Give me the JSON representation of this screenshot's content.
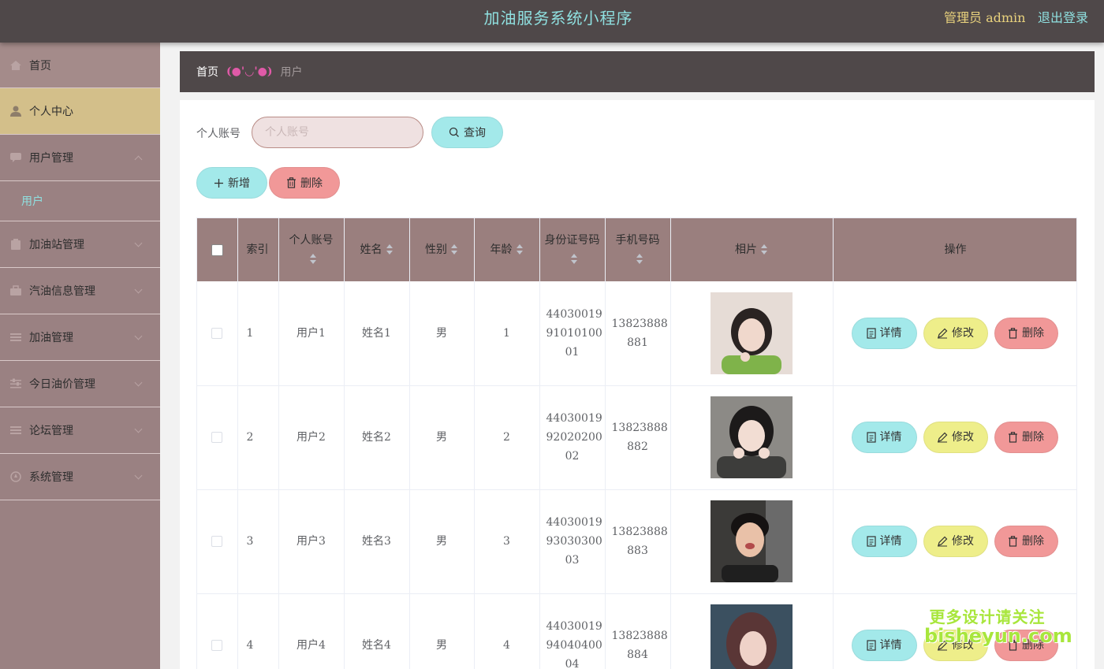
{
  "header": {
    "title": "加油服务系统小程序",
    "admin_label": "管理员 admin",
    "logout_label": "退出登录"
  },
  "sidebar": {
    "items": [
      {
        "label": "首页",
        "icon": "home-icon"
      },
      {
        "label": "个人中心",
        "icon": "user-icon"
      },
      {
        "label": "用户管理",
        "icon": "chat-icon",
        "expanded": true,
        "children": [
          "用户"
        ]
      },
      {
        "label": "加油站管理",
        "icon": "clipboard-icon"
      },
      {
        "label": "汽油信息管理",
        "icon": "briefcase-icon"
      },
      {
        "label": "加油管理",
        "icon": "list-icon"
      },
      {
        "label": "今日油价管理",
        "icon": "sliders-icon"
      },
      {
        "label": "论坛管理",
        "icon": "list-icon"
      },
      {
        "label": "系统管理",
        "icon": "compass-icon"
      }
    ]
  },
  "breadcrumb": {
    "home": "首页",
    "separator": "(●'◡'●)",
    "current": "用户"
  },
  "search": {
    "label": "个人账号",
    "placeholder": "个人账号",
    "value": "",
    "button_label": "查询"
  },
  "actions": {
    "add_label": "新增",
    "delete_label": "删除"
  },
  "table": {
    "columns": [
      "索引",
      "个人账号",
      "姓名",
      "性别",
      "年龄",
      "身份证号码",
      "手机号码",
      "相片",
      "操作"
    ],
    "rows": [
      {
        "index": "1",
        "account": "用户1",
        "name": "姓名1",
        "gender": "男",
        "age": "1",
        "id_lines": [
          "44030019",
          "91010100",
          "01"
        ],
        "phone_lines": [
          "13823888",
          "881"
        ]
      },
      {
        "index": "2",
        "account": "用户2",
        "name": "姓名2",
        "gender": "男",
        "age": "2",
        "id_lines": [
          "44030019",
          "92020200",
          "02"
        ],
        "phone_lines": [
          "13823888",
          "882"
        ]
      },
      {
        "index": "3",
        "account": "用户3",
        "name": "姓名3",
        "gender": "男",
        "age": "3",
        "id_lines": [
          "44030019",
          "93030300",
          "03"
        ],
        "phone_lines": [
          "13823888",
          "883"
        ]
      },
      {
        "index": "4",
        "account": "用户4",
        "name": "姓名4",
        "gender": "男",
        "age": "4",
        "id_lines": [
          "44030019",
          "94040400",
          "04"
        ],
        "phone_lines": [
          "13823888",
          "884"
        ]
      }
    ],
    "row_actions": {
      "detail_label": "详情",
      "edit_label": "修改",
      "delete_label": "删除"
    }
  },
  "watermark": {
    "line1": "更多设计请关注",
    "line2": "bisheyun.com"
  },
  "colors": {
    "topbar": "#4f4849",
    "title_cyan": "#8fe0e0",
    "admin_gold": "#e9d27d",
    "sidebar": "#9a8182",
    "sidebar_active": "#d3bf8a",
    "table_header": "#9a7f7e",
    "btn_cyan": "#a3e9ea",
    "btn_red": "#f19898",
    "btn_yellow": "#eeee8a"
  }
}
